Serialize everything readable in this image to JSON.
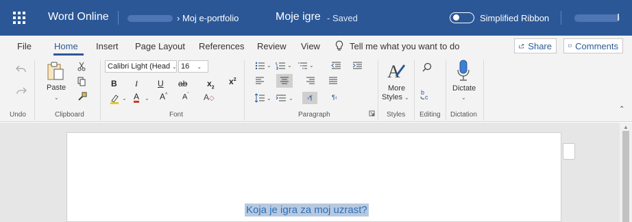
{
  "titlebar": {
    "app_name": "Word Online",
    "path": "› Moj e-portfolio",
    "doc_name": "Moje igre",
    "status": "-  Saved",
    "ribbon_toggle_label": "Simplified Ribbon",
    "account_suffix": "I",
    "accent_color": "#2b5797"
  },
  "tabs": {
    "items": [
      "File",
      "Home",
      "Insert",
      "Page Layout",
      "References",
      "Review",
      "View"
    ],
    "active": "Home",
    "tell_me": "Tell me what you want to do",
    "share": "Share",
    "comments": "Comments"
  },
  "ribbon": {
    "undo_group": "Undo",
    "clipboard": {
      "paste": "Paste",
      "group": "Clipboard"
    },
    "font": {
      "family": "Calibri Light (Head",
      "size": "16",
      "bold": "B",
      "italic": "I",
      "underline": "U",
      "strike": "ab",
      "subscript": "x",
      "superscript": "x",
      "font_color": "A",
      "grow": "A",
      "shrink": "A",
      "group": "Font"
    },
    "paragraph": {
      "ltr": "¶",
      "rtl": "¶",
      "group": "Paragraph"
    },
    "styles": {
      "button": "More",
      "button2": "Styles",
      "group": "Styles"
    },
    "editing": {
      "group": "Editing"
    },
    "dictation": {
      "button": "Dictate",
      "group": "Dictation"
    }
  },
  "document": {
    "text": "Koja je igra za moj uzrast?"
  }
}
